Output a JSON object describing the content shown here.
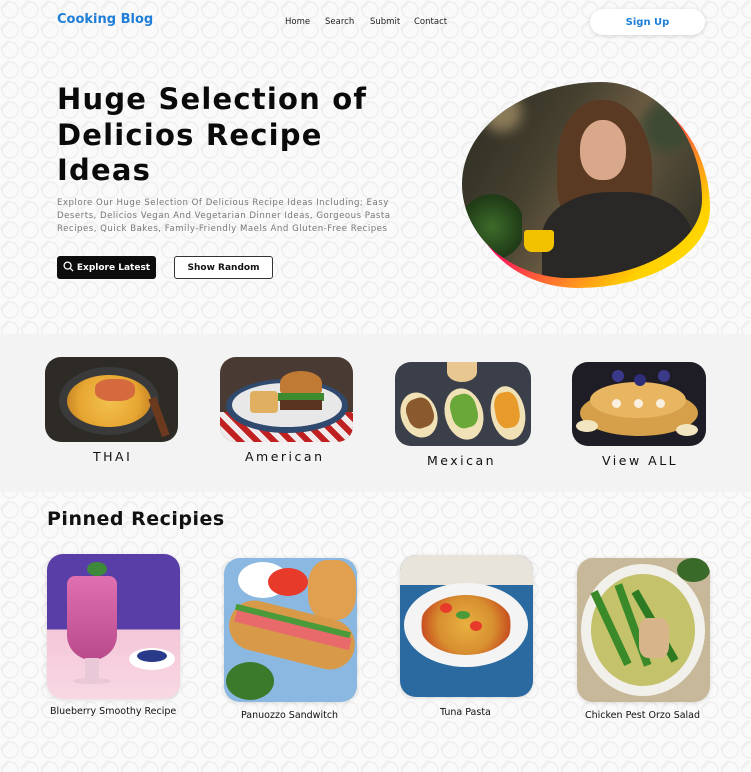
{
  "nav": {
    "logo": "Cooking Blog",
    "links": [
      "Home",
      "Search",
      "Submit",
      "Contact"
    ],
    "signup": "Sign Up"
  },
  "hero": {
    "title": "Huge Selection of Delicios Recipe Ideas",
    "description": "Explore Our Huge Selection Of Delicious Recipe Ideas Including; Easy Deserts, Delicios Vegan And Vegetarian Dinner Ideas, Gorgeous Pasta Recipes, Quick Bakes, Family-Friendly Maels And Gluten-Free Recipes",
    "explore_label": "Explore Latest",
    "random_label": "Show Random"
  },
  "categories": [
    {
      "label": "THAI",
      "icon": "thai-curry-image"
    },
    {
      "label": "American",
      "icon": "burger-image"
    },
    {
      "label": "Mexican",
      "icon": "tacos-image"
    },
    {
      "label": "View ALL",
      "icon": "pancakes-image"
    }
  ],
  "pinned": {
    "title": "Pinned Recipies",
    "items": [
      {
        "label": "Blueberry Smoothy Recipe"
      },
      {
        "label": "Panuozzo Sandwitch"
      },
      {
        "label": "Tuna Pasta"
      },
      {
        "label": "Chicken Pest Orzo Salad"
      }
    ]
  },
  "colors": {
    "brand": "#1e7ed8",
    "accent_pink": "#ff0066",
    "accent_yellow": "#ffe600"
  }
}
